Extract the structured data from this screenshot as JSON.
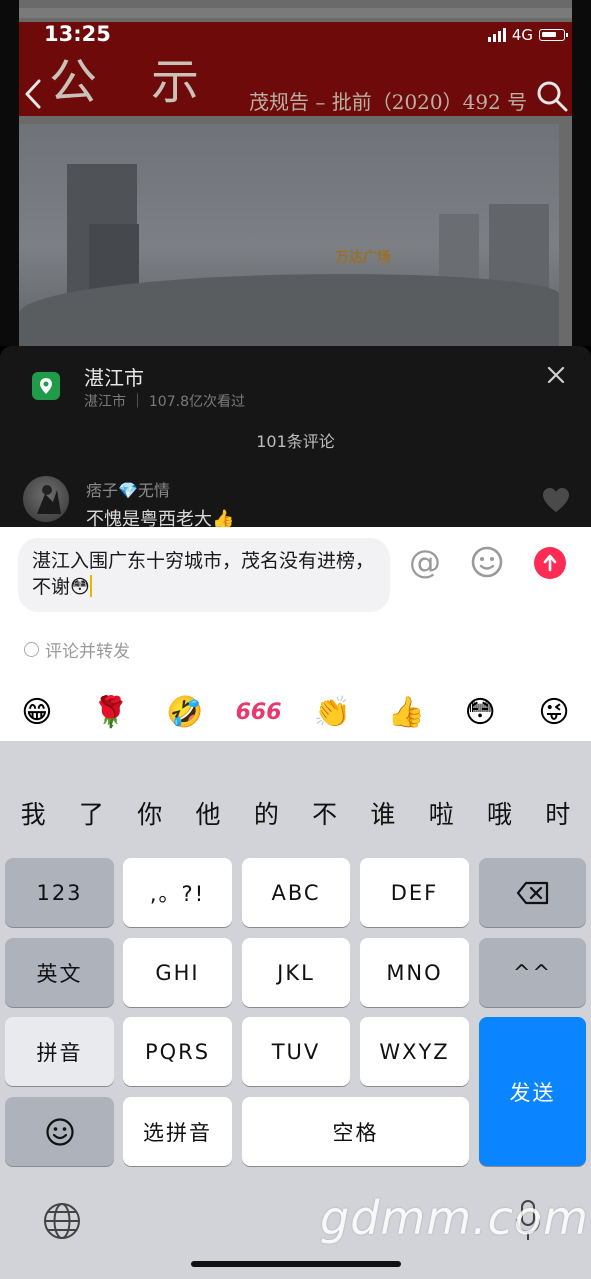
{
  "status_bar": {
    "time": "13:25",
    "network": "4G"
  },
  "video": {
    "notice_char1": "公",
    "notice_char2": "示",
    "notice_ref": "茂规告 – 批前（2020）492 号",
    "mall_logo": "万达广场"
  },
  "comment_panel": {
    "location_title": "湛江市",
    "location_subtitle": "湛江市 ｜ 107.8亿次看过",
    "comment_count": "101条评论",
    "comment": {
      "user": "痞子💎无情",
      "text": "不愧是粤西老大👍"
    }
  },
  "input": {
    "text": "湛江入围广东十穷城市，茂名没有进榜，不谢😳",
    "at_label": "@",
    "repost_label": "评论并转发"
  },
  "emojis": [
    "😁",
    "🌹",
    "🤣",
    "666",
    "👏",
    "👍",
    "😳",
    "😜"
  ],
  "keyboard": {
    "candidates": [
      "我",
      "了",
      "你",
      "他",
      "的",
      "不",
      "谁",
      "啦",
      "哦",
      "时"
    ],
    "keys": {
      "num": "123",
      "punct": ",。?!",
      "abc": "ABC",
      "def": "DEF",
      "english": "英文",
      "ghi": "GHI",
      "jkl": "JKL",
      "mno": "MNO",
      "emoticon": "^^",
      "pinyin": "拼音",
      "pqrs": "PQRS",
      "tuv": "TUV",
      "wxyz": "WXYZ",
      "send": "发送",
      "select_pinyin": "选拼音",
      "space": "空格"
    }
  },
  "watermark": "gdmm.com",
  "colors": {
    "send_red": "#fe2c55",
    "send_key_blue": "#0b84ff",
    "location_green": "#1f9b4a"
  }
}
